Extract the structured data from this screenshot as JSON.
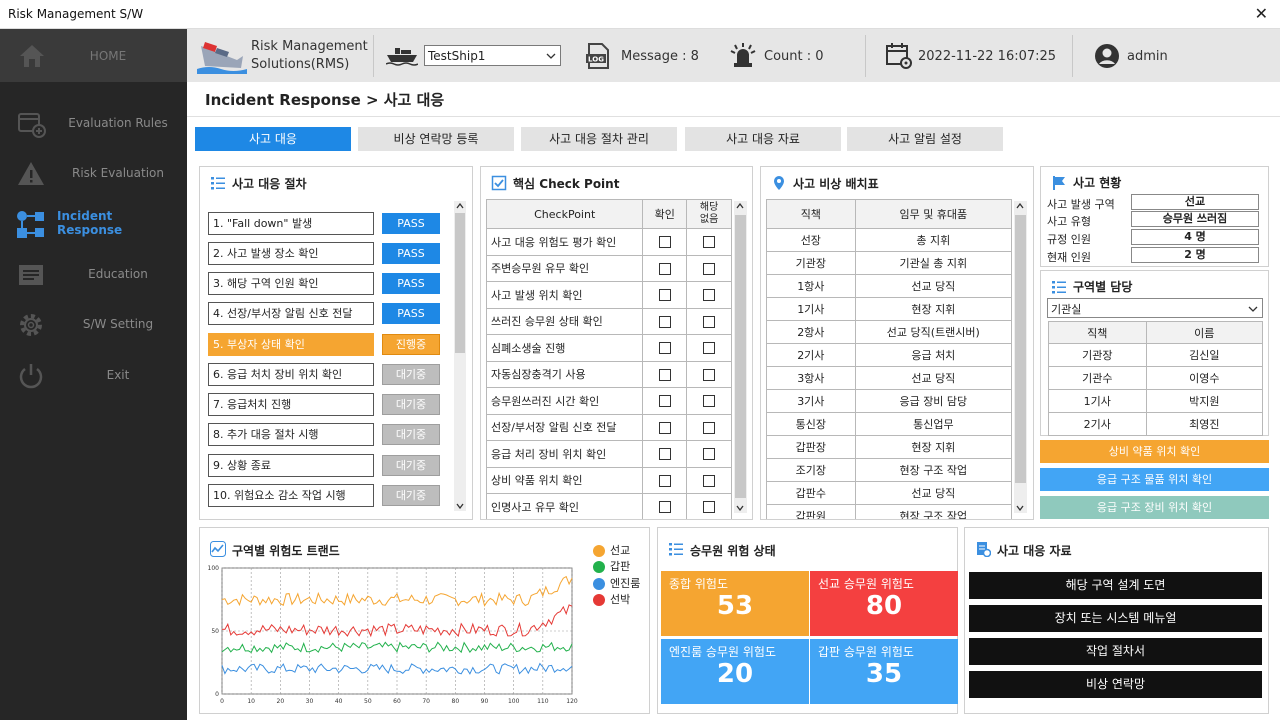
{
  "window": {
    "title": "Risk Management S/W",
    "close": "✕"
  },
  "sidebar": {
    "items": [
      {
        "label": "HOME",
        "icon": "home-icon"
      },
      {
        "label": "Evaluation Rules",
        "icon": "add-window-icon"
      },
      {
        "label": "Risk Evaluation",
        "icon": "warning-icon"
      },
      {
        "label": "Incident Response",
        "icon": "flow-icon"
      },
      {
        "label": "Education",
        "icon": "list-icon"
      },
      {
        "label": "S/W Setting",
        "icon": "gear-icon"
      },
      {
        "label": "Exit",
        "icon": "power-icon"
      }
    ]
  },
  "header": {
    "logo_line1": "Risk Management",
    "logo_line2": "Solutions(RMS)",
    "ship_select": "TestShip1",
    "message": "Message : 8",
    "count": "Count : 0",
    "datetime": "2022-11-22 16:07:25",
    "user": "admin"
  },
  "breadcrumb": "Incident Response > 사고 대응",
  "tabs": [
    "사고 대응",
    "비상 연락망 등록",
    "사고 대응 절차 관리",
    "사고 대응 자료",
    "사고 알림 설정"
  ],
  "procedure": {
    "title": "사고 대응 절차",
    "steps": [
      {
        "label": "1. \"Fall down\" 발생",
        "status": "PASS",
        "state": "pass"
      },
      {
        "label": "2. 사고 발생 장소 확인",
        "status": "PASS",
        "state": "pass"
      },
      {
        "label": "3. 해당 구역 인원 확인",
        "status": "PASS",
        "state": "pass"
      },
      {
        "label": "4. 선장/부서장 알림 신호 전달",
        "status": "PASS",
        "state": "pass"
      },
      {
        "label": "5. 부상자 상태 확인",
        "status": "진행중",
        "state": "prog"
      },
      {
        "label": "6. 응급 처치 장비 위치 확인",
        "status": "대기중",
        "state": "wait"
      },
      {
        "label": "7. 응급처치 진행",
        "status": "대기중",
        "state": "wait"
      },
      {
        "label": "8. 추가 대응 절차 시행",
        "status": "대기중",
        "state": "wait"
      },
      {
        "label": "9. 상황 종료",
        "status": "대기중",
        "state": "wait"
      },
      {
        "label": "10. 위험요소 감소 작업 시행",
        "status": "대기중",
        "state": "wait"
      }
    ]
  },
  "checkpoint": {
    "title": "핵심 Check Point",
    "headers": [
      "CheckPoint",
      "확인",
      "해당\n없음"
    ],
    "rows": [
      "사고 대응 위험도 평가 확인",
      "주변승무원 유무 확인",
      "사고 발생 위치 확인",
      "쓰러진 승무원 상태 확인",
      "심폐소생술 진행",
      "자동심장충격기 사용",
      "승무원쓰러진 시간 확인",
      "선장/부서장 알림 신호 전달",
      "응급 처리 장비 위치 확인",
      "상비 약품 위치 확인",
      "인명사고 유무 확인"
    ]
  },
  "deployment": {
    "title": "사고 비상 배치표",
    "headers": [
      "직책",
      "임무 및 휴대품"
    ],
    "rows": [
      [
        "선장",
        "총 지휘"
      ],
      [
        "기관장",
        "기관실 총 지휘"
      ],
      [
        "1항사",
        "선교 당직"
      ],
      [
        "1기사",
        "현장 지휘"
      ],
      [
        "2항사",
        "선교 당직(트랜시버)"
      ],
      [
        "2기사",
        "응급 처치"
      ],
      [
        "3항사",
        "선교 당직"
      ],
      [
        "3기사",
        "응급 장비 담당"
      ],
      [
        "통신장",
        "통신업무"
      ],
      [
        "갑판장",
        "현장 지휘"
      ],
      [
        "조기장",
        "현장 구조 작업"
      ],
      [
        "갑판수",
        "선교 당직"
      ],
      [
        "갑판원",
        "현장 구조 작업"
      ]
    ]
  },
  "status": {
    "title": "사고 현황",
    "items": [
      {
        "k": "사고 발생 구역",
        "v": "선교"
      },
      {
        "k": "사고 유형",
        "v": "승무원 쓰러짐"
      },
      {
        "k": "규정 인원",
        "v": "4 명"
      },
      {
        "k": "현재 인원",
        "v": "2 명"
      }
    ]
  },
  "zone": {
    "title": "구역별 담당",
    "select": "기관실",
    "headers": [
      "직책",
      "이름"
    ],
    "rows": [
      [
        "기관장",
        "김신일"
      ],
      [
        "기관수",
        "이영수"
      ],
      [
        "1기사",
        "박지원"
      ],
      [
        "2기사",
        "최영진"
      ]
    ]
  },
  "actions": [
    {
      "label": "상비 약품 위치 확인",
      "color": "#f5a531"
    },
    {
      "label": "응급 구조 물품 위치 확인",
      "color": "#42a5f5"
    },
    {
      "label": "응급 구조 장비 위치 확인",
      "color": "#8fc9bd"
    }
  ],
  "trend": {
    "title": "구역별 위험도 트랜드"
  },
  "chart_data": {
    "type": "line",
    "title": "구역별 위험도 트랜드",
    "ylim": [
      0,
      100
    ],
    "xlim": [
      0,
      120
    ],
    "yticks": [
      "0",
      "50",
      "100"
    ],
    "xticks": [
      "0",
      "10",
      "20",
      "30",
      "40",
      "50",
      "60",
      "70",
      "80",
      "90",
      "100",
      "110",
      "120"
    ],
    "series": [
      {
        "name": "선교",
        "color": "#f5a531",
        "base": 75,
        "amp": 5,
        "end": 92
      },
      {
        "name": "갑판",
        "color": "#22b14c",
        "base": 37,
        "amp": 4,
        "end": 38
      },
      {
        "name": "엔진룸",
        "color": "#3b8fe0",
        "base": 20,
        "amp": 4,
        "end": 22
      },
      {
        "name": "선박",
        "color": "#e53935",
        "base": 51,
        "amp": 5,
        "end": 68
      }
    ]
  },
  "crew": {
    "title": "승무원 위험 상태",
    "boxes": [
      {
        "label": "종합 위험도",
        "value": "53",
        "color": "#f5a531"
      },
      {
        "label": "선교 승무원 위험도",
        "value": "80",
        "color": "#f44040"
      },
      {
        "label": "엔진룸 승무원 위험도",
        "value": "20",
        "color": "#42a5f5"
      },
      {
        "label": "갑판 승무원 위험도",
        "value": "35",
        "color": "#42a5f5"
      }
    ]
  },
  "docs": {
    "title": "사고 대응 자료",
    "buttons": [
      "해당 구역 설계 도면",
      "장치 또는 시스템 메뉴얼",
      "작업 절차서",
      "비상 연락망"
    ]
  }
}
